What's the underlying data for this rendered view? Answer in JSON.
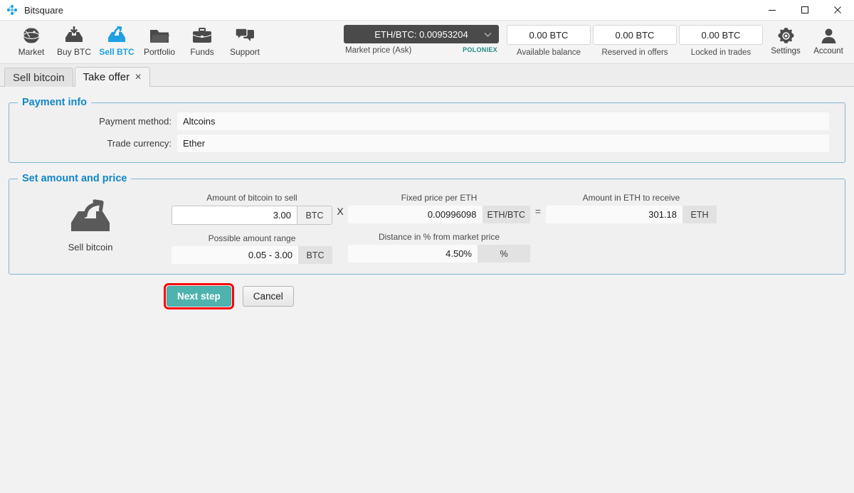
{
  "window": {
    "title": "Bitsquare",
    "logo_icon": "bitsquare-logo-icon",
    "minimize_icon": "minimize-icon",
    "maximize_icon": "maximize-icon",
    "close_icon": "close-icon"
  },
  "nav": {
    "items": [
      {
        "label": "Market",
        "icon": "globe-icon",
        "active": false
      },
      {
        "label": "Buy BTC",
        "icon": "buy-btc-icon",
        "active": false
      },
      {
        "label": "Sell BTC",
        "icon": "sell-btc-icon",
        "active": true
      },
      {
        "label": "Portfolio",
        "icon": "folder-icon",
        "active": false
      },
      {
        "label": "Funds",
        "icon": "briefcase-icon",
        "active": false
      },
      {
        "label": "Support",
        "icon": "chat-icon",
        "active": false
      }
    ],
    "market_price": {
      "value": "ETH/BTC: 0.00953204",
      "caption": "Market price (Ask)",
      "provider": "POLONIEX",
      "chevron_icon": "chevron-down-icon"
    },
    "balances": [
      {
        "value": "0.00 BTC",
        "label": "Available balance"
      },
      {
        "value": "0.00 BTC",
        "label": "Reserved in offers"
      },
      {
        "value": "0.00 BTC",
        "label": "Locked in trades"
      }
    ],
    "settings": {
      "label": "Settings",
      "icon": "gear-icon"
    },
    "account": {
      "label": "Account",
      "icon": "person-icon"
    }
  },
  "tabs": [
    {
      "label": "Sell bitcoin",
      "active": false,
      "closable": false
    },
    {
      "label": "Take offer",
      "active": true,
      "closable": true,
      "close_icon": "close-icon"
    }
  ],
  "payment_info": {
    "legend": "Payment info",
    "rows": [
      {
        "label": "Payment method:",
        "value": "Altcoins"
      },
      {
        "label": "Trade currency:",
        "value": "Ether"
      }
    ]
  },
  "amount_price": {
    "legend": "Set amount and price",
    "icon": "sell-bitcoin-icon",
    "icon_label": "Sell bitcoin",
    "amount": {
      "caption": "Amount of bitcoin to sell",
      "value": "3.00",
      "suffix": "BTC"
    },
    "operator_multiply": "X",
    "price": {
      "caption": "Fixed price per ETH",
      "value": "0.00996098",
      "suffix": "ETH/BTC"
    },
    "operator_equals": "=",
    "receive": {
      "caption": "Amount in ETH to receive",
      "value": "301.18",
      "suffix": "ETH"
    },
    "range": {
      "caption": "Possible amount range",
      "value": "0.05 - 3.00",
      "suffix": "BTC"
    },
    "distance": {
      "caption": "Distance in % from market price",
      "value": "4.50%",
      "suffix": "%"
    }
  },
  "actions": {
    "next_label": "Next step",
    "cancel_label": "Cancel",
    "highlight_color": "#ff0000",
    "primary_color": "#4eb3ad"
  }
}
